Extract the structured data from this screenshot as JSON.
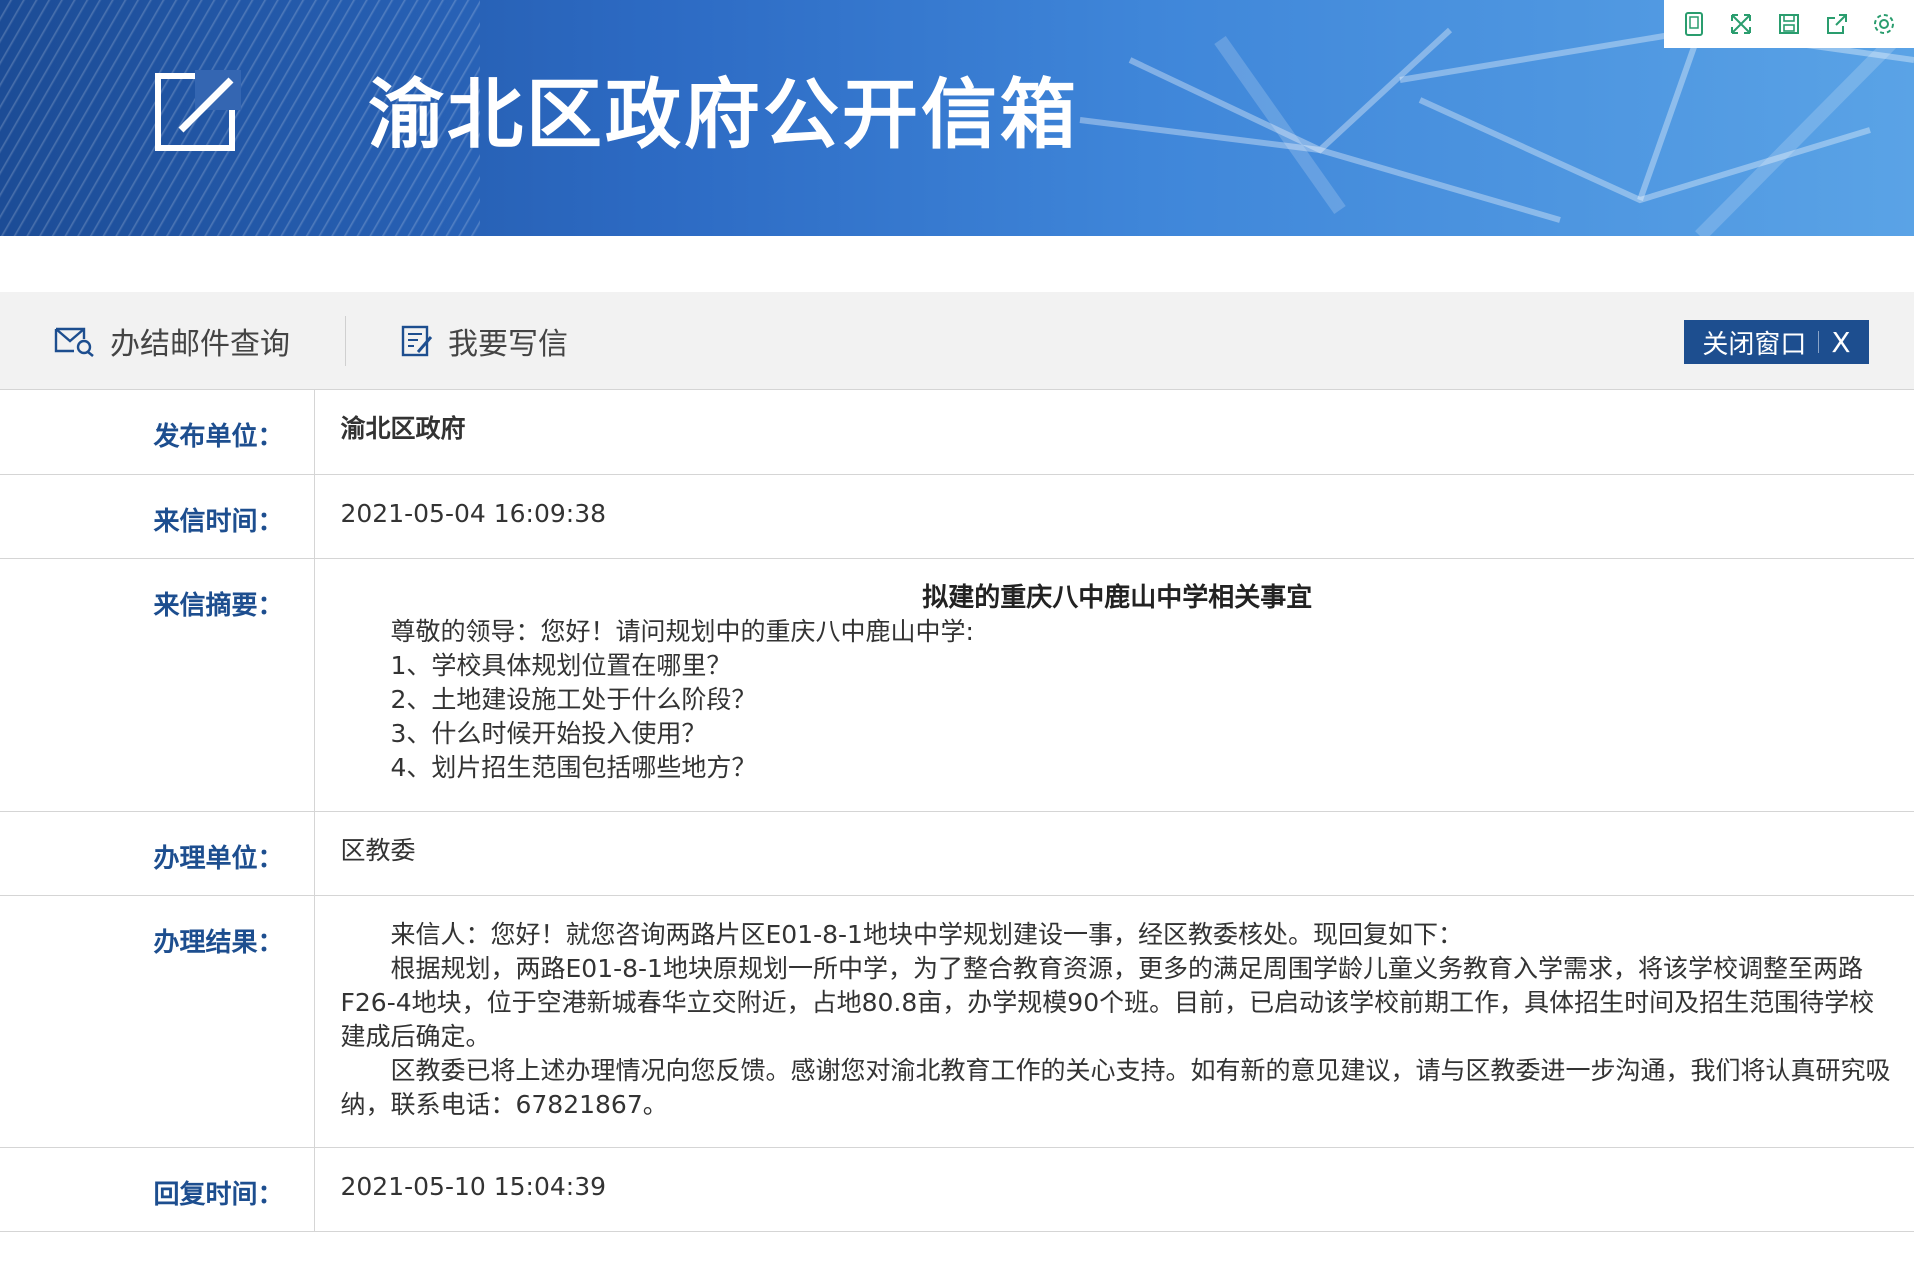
{
  "banner": {
    "title": "渝北区政府公开信箱"
  },
  "toolbar": {
    "query_label": "办结邮件查询",
    "write_label": "我要写信",
    "close_label": "关闭窗口",
    "close_x": "X"
  },
  "fields": {
    "publisher": {
      "label": "发布单位：",
      "value": "渝北区政府"
    },
    "letter_time": {
      "label": "来信时间：",
      "value": "2021-05-04 16:09:38"
    },
    "summary": {
      "label": "来信摘要：",
      "title": "拟建的重庆八中鹿山中学相关事宜",
      "lines": [
        "尊敬的领导：您好！请问规划中的重庆八中鹿山中学:",
        "1、学校具体规划位置在哪里？",
        "2、土地建设施工处于什么阶段？",
        "3、什么时候开始投入使用？",
        "4、划片招生范围包括哪些地方？"
      ]
    },
    "handler": {
      "label": "办理单位：",
      "value": "区教委"
    },
    "result": {
      "label": "办理结果：",
      "paragraphs": [
        "来信人：您好！就您咨询两路片区E01-8-1地块中学规划建设一事，经区教委核处。现回复如下：",
        "根据规划，两路E01-8-1地块原规划一所中学，为了整合教育资源，更多的满足周围学龄儿童义务教育入学需求，将该学校调整至两路F26-4地块，位于空港新城春华立交附近，占地80.8亩，办学规模90个班。目前，已启动该学校前期工作，具体招生时间及招生范围待学校建成后确定。",
        "区教委已将上述办理情况向您反馈。感谢您对渝北教育工作的关心支持。如有新的意见建议，请与区教委进一步沟通，我们将认真研究吸纳，联系电话：67821867。"
      ]
    },
    "reply_time": {
      "label": "回复时间：",
      "value": "2021-05-10 15:04:39"
    }
  },
  "colors": {
    "accent": "#1d4e8f",
    "banner_start": "#1c4c96",
    "banner_end": "#5aa3e6"
  },
  "icons": [
    "phone-view-icon",
    "fullscreen-icon",
    "save-icon",
    "share-icon",
    "settings-icon",
    "logo-edit-icon",
    "mail-search-icon",
    "write-letter-icon"
  ]
}
